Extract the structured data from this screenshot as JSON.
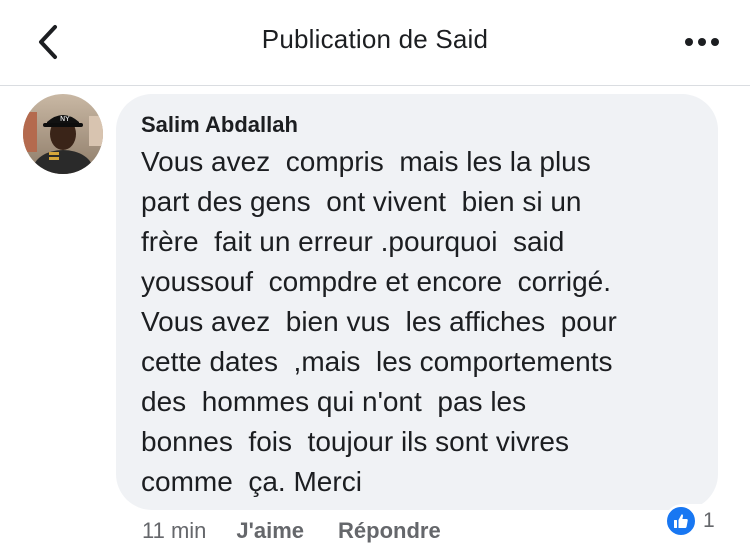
{
  "header": {
    "title": "Publication de Said",
    "back_icon": "chevron-left-icon",
    "more_icon": "more-horizontal-icon"
  },
  "comment": {
    "author": "Salim Abdallah",
    "lines": [
      "Vous avez  compris  mais les la plus",
      "part des gens  ont vivent  bien si un",
      "frère  fait un erreur .pourquoi  said",
      "youssouf  compdre et encore  corrigé.",
      "Vous avez  bien vus  les affiches  pour",
      "cette dates  ,mais  les comportements",
      "des  hommes qui n'ont  pas les",
      "bonnes  fois  toujour ils sont vivres",
      "comme  ça. Merci"
    ],
    "time": "11 min",
    "like_label": "J'aime",
    "reply_label": "Répondre",
    "reaction_icon": "thumbs-up-icon",
    "reaction_count": "1"
  },
  "colors": {
    "bubble": "#f0f2f5",
    "secondary_text": "#65676b",
    "like_blue": "#1877f2"
  }
}
